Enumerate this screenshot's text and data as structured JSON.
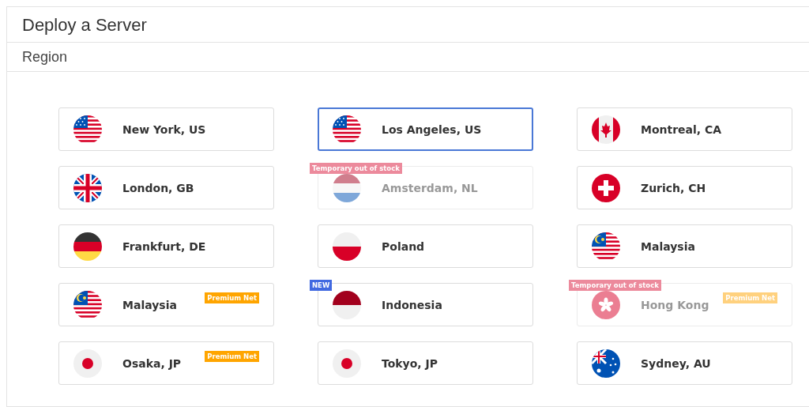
{
  "title": "Deploy a Server",
  "section": "Region",
  "locations": [
    {
      "name": "New York, US",
      "kind": "us",
      "selected": false,
      "disabled": false
    },
    {
      "name": "Los Angeles, US",
      "kind": "us",
      "selected": true,
      "disabled": false
    },
    {
      "name": "Montreal, CA",
      "kind": "ca",
      "selected": false,
      "disabled": false
    },
    {
      "name": "London, GB",
      "kind": "gb",
      "selected": false,
      "disabled": false
    },
    {
      "name": "Amsterdam, NL",
      "kind": "nl",
      "selected": false,
      "disabled": true,
      "corner_badge": {
        "kind": "stock",
        "text": "Temporary out of stock"
      }
    },
    {
      "name": "Zurich, CH",
      "kind": "ch",
      "selected": false,
      "disabled": false
    },
    {
      "name": "Frankfurt, DE",
      "kind": "de",
      "selected": false,
      "disabled": false
    },
    {
      "name": "Poland",
      "kind": "pl",
      "selected": false,
      "disabled": false
    },
    {
      "name": "Malaysia",
      "kind": "my",
      "selected": false,
      "disabled": false
    },
    {
      "name": "Malaysia",
      "kind": "my",
      "selected": false,
      "disabled": false,
      "premium_badge": "Premium Net"
    },
    {
      "name": "Indonesia",
      "kind": "id",
      "selected": false,
      "disabled": false,
      "corner_badge": {
        "kind": "new",
        "text": "NEW"
      }
    },
    {
      "name": "Hong Kong",
      "kind": "hk",
      "selected": false,
      "disabled": true,
      "corner_badge": {
        "kind": "stock",
        "text": "Temporary out of stock"
      },
      "premium_badge": "Premium Net"
    },
    {
      "name": "Osaka, JP",
      "kind": "jp",
      "selected": false,
      "disabled": false,
      "premium_badge": "Premium Net"
    },
    {
      "name": "Tokyo, JP",
      "kind": "jp",
      "selected": false,
      "disabled": false
    },
    {
      "name": "Sydney, AU",
      "kind": "au",
      "selected": false,
      "disabled": false
    }
  ]
}
